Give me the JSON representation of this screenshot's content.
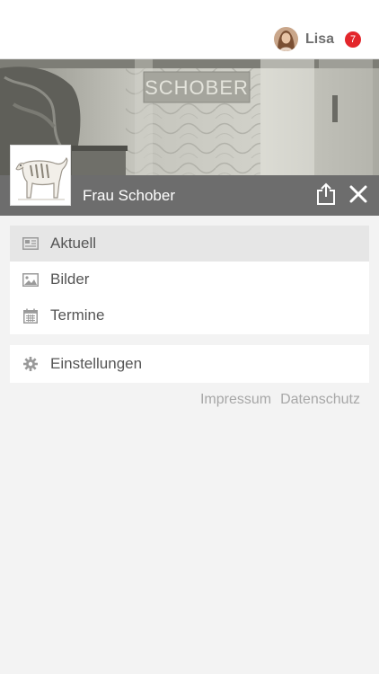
{
  "user": {
    "name": "Lisa",
    "notification_count": "7"
  },
  "hero": {
    "sign_text": "SCHOBER"
  },
  "profile": {
    "name": "Frau Schober"
  },
  "menu": {
    "items": [
      {
        "label": "Aktuell",
        "icon": "newspaper-icon",
        "active": true
      },
      {
        "label": "Bilder",
        "icon": "image-icon",
        "active": false
      },
      {
        "label": "Termine",
        "icon": "calendar-icon",
        "active": false
      }
    ],
    "settings": {
      "label": "Einstellungen",
      "icon": "gear-icon"
    }
  },
  "footer": {
    "impressum": "Impressum",
    "datenschutz": "Datenschutz"
  },
  "colors": {
    "badge": "#e3262b",
    "titlebar": "#6d6d6d",
    "active_row": "#e6e6e6",
    "background": "#f3f3f3"
  }
}
